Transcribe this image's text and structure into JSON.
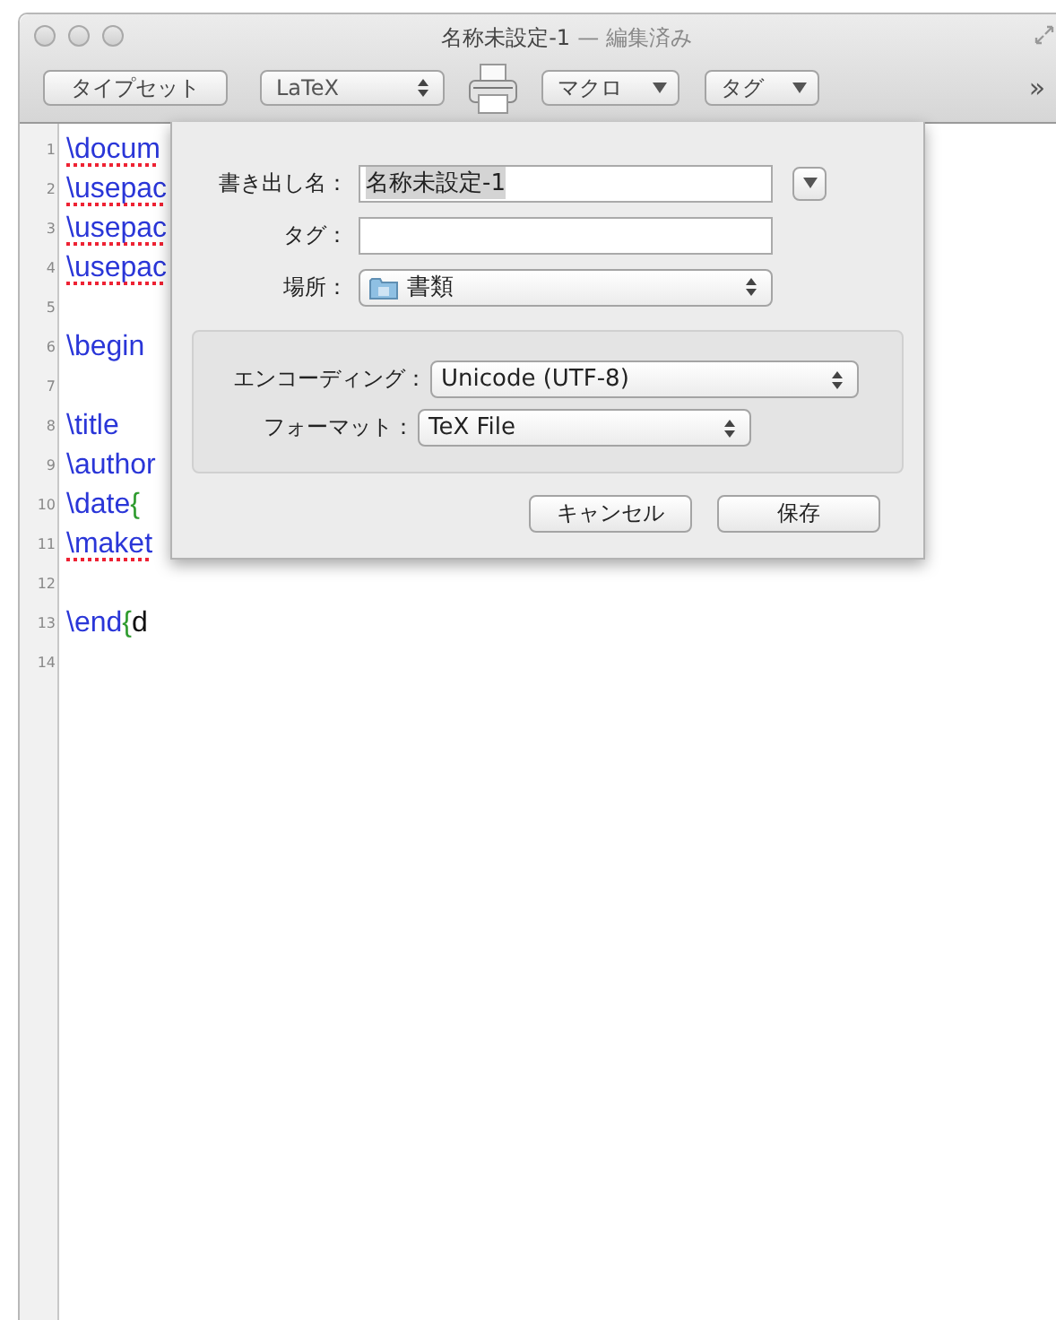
{
  "window": {
    "title": "名称未設定-1",
    "subtitle": "— 編集済み"
  },
  "toolbar": {
    "typeset_button": "タイプセット",
    "format_popup": "LaTeX",
    "macro_menu": "マクロ",
    "tag_menu": "タグ",
    "overflow": "»"
  },
  "editor": {
    "lines": [
      {
        "number": "1",
        "segments": [
          {
            "kind": "command",
            "text": "\\docum",
            "spell_error": true
          }
        ]
      },
      {
        "number": "2",
        "segments": [
          {
            "kind": "command",
            "text": "\\usepac",
            "spell_error": true
          }
        ]
      },
      {
        "number": "3",
        "segments": [
          {
            "kind": "command",
            "text": "\\usepac",
            "spell_error": true
          }
        ]
      },
      {
        "number": "4",
        "segments": [
          {
            "kind": "command",
            "text": "\\usepac",
            "spell_error": true
          }
        ]
      },
      {
        "number": "5"
      },
      {
        "number": "6",
        "segments": [
          {
            "kind": "command",
            "text": "\\begin",
            "spell_error": false
          }
        ]
      },
      {
        "number": "7"
      },
      {
        "number": "8",
        "segments": [
          {
            "kind": "command",
            "text": "\\title",
            "spell_error": false
          }
        ]
      },
      {
        "number": "9",
        "segments": [
          {
            "kind": "command",
            "text": "\\author",
            "spell_error": false
          }
        ]
      },
      {
        "number": "10",
        "segments": [
          {
            "kind": "command",
            "text": "\\date",
            "spell_error": false
          },
          {
            "kind": "brace",
            "text": "{",
            "spell_error": false
          }
        ]
      },
      {
        "number": "11",
        "segments": [
          {
            "kind": "command",
            "text": "\\maket",
            "spell_error": true
          }
        ]
      },
      {
        "number": "12"
      },
      {
        "number": "13",
        "segments": [
          {
            "kind": "command",
            "text": "\\end",
            "spell_error": false
          },
          {
            "kind": "brace",
            "text": "{",
            "spell_error": false
          },
          {
            "kind": "text",
            "text": "d",
            "spell_error": false
          }
        ]
      },
      {
        "number": "14"
      }
    ]
  },
  "save_sheet": {
    "name_label": "書き出し名：",
    "name_value": "名称未設定-1",
    "tags_label": "タグ：",
    "location_label": "場所：",
    "location_value": "書類",
    "encoding_label": "エンコーディング：",
    "encoding_value": "Unicode (UTF-8)",
    "format_label": "フォーマット：",
    "format_value": "TeX File",
    "cancel_button": "キャンセル",
    "save_button": "保存"
  }
}
